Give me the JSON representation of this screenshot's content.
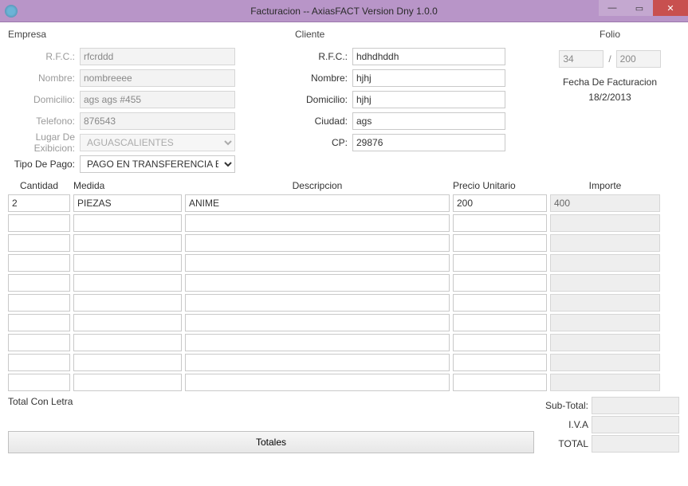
{
  "window": {
    "title": "Facturacion -- AxiasFACT Version Dny 1.0.0"
  },
  "sections": {
    "empresa": "Empresa",
    "cliente": "Cliente",
    "folio": "Folio",
    "fecha_label": "Fecha De Facturacion",
    "fecha_value": "18/2/2013",
    "total_con_letra": "Total Con Letra"
  },
  "empresa": {
    "labels": {
      "rfc": "R.F.C.:",
      "nombre": "Nombre:",
      "domicilio": "Domicilio:",
      "telefono": "Telefono:",
      "lugar": "Lugar De Exibicion:",
      "tipo_pago": "Tipo De Pago:"
    },
    "rfc": "rfcrddd",
    "nombre": "nombreeee",
    "domicilio": "ags ags #455",
    "telefono": "876543",
    "lugar": "AGUASCALIENTES",
    "tipo_pago": "PAGO EN TRANSFERENCIA BANC"
  },
  "cliente": {
    "labels": {
      "rfc": "R.F.C.:",
      "nombre": "Nombre:",
      "domicilio": "Domicilio:",
      "ciudad": "Ciudad:",
      "cp": "CP:"
    },
    "rfc": "hdhdhddh",
    "nombre": "hjhj",
    "domicilio": "hjhj",
    "ciudad": "ags",
    "cp": "29876"
  },
  "folio": {
    "left": "34",
    "sep": "/",
    "right": "200"
  },
  "grid": {
    "headers": {
      "cantidad": "Cantidad",
      "medida": "Medida",
      "descripcion": "Descripcion",
      "precio": "Precio Unitario",
      "importe": "Importe"
    },
    "rows": [
      {
        "cantidad": "2",
        "medida": "PIEZAS",
        "descripcion": "ANIME",
        "precio": "200",
        "importe": "400"
      },
      {
        "cantidad": "",
        "medida": "",
        "descripcion": "",
        "precio": "",
        "importe": ""
      },
      {
        "cantidad": "",
        "medida": "",
        "descripcion": "",
        "precio": "",
        "importe": ""
      },
      {
        "cantidad": "",
        "medida": "",
        "descripcion": "",
        "precio": "",
        "importe": ""
      },
      {
        "cantidad": "",
        "medida": "",
        "descripcion": "",
        "precio": "",
        "importe": ""
      },
      {
        "cantidad": "",
        "medida": "",
        "descripcion": "",
        "precio": "",
        "importe": ""
      },
      {
        "cantidad": "",
        "medida": "",
        "descripcion": "",
        "precio": "",
        "importe": ""
      },
      {
        "cantidad": "",
        "medida": "",
        "descripcion": "",
        "precio": "",
        "importe": ""
      },
      {
        "cantidad": "",
        "medida": "",
        "descripcion": "",
        "precio": "",
        "importe": ""
      },
      {
        "cantidad": "",
        "medida": "",
        "descripcion": "",
        "precio": "",
        "importe": ""
      }
    ]
  },
  "totals": {
    "labels": {
      "subtotal": "Sub-Total:",
      "iva": "I.V.A",
      "total": "TOTAL"
    },
    "subtotal": "",
    "iva": "",
    "total": "",
    "button": "Totales"
  }
}
